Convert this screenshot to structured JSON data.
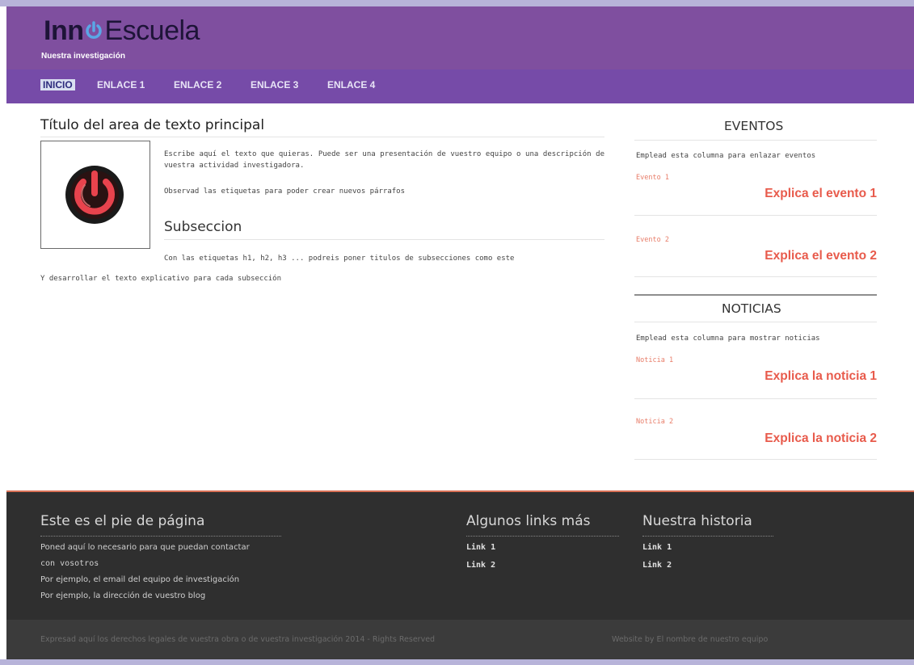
{
  "header": {
    "logo_part1": "Inn",
    "logo_part2": "Escuela",
    "logo_icon": "power-icon",
    "tagline": "Nuestra investigación",
    "bg_color": "#7f4f9f"
  },
  "nav": {
    "items": [
      "INICIO",
      "ENLACE 1",
      "ENLACE 2",
      "ENLACE 3",
      "ENLACE 4"
    ],
    "active": "INICIO",
    "bg_color": "#764ba8"
  },
  "main": {
    "title": "Título del area de texto principal",
    "image_icon": "power-button-icon",
    "para1": "Escribe aquí el texto que quieras. Puede ser una presentación de vuestro equipo o una descripción de vuestra actividad investigadora.",
    "para2": "Observad las etiquetas para poder crear nuevos párrafos",
    "subsection_title": "Subseccion",
    "para3": "Con las etiquetas h1, h2, h3 ... podreis poner titulos de subsecciones como este",
    "para4": "Y desarrollar el texto explicativo para cada subsección"
  },
  "sidebar": {
    "eventos": {
      "title": "EVENTOS",
      "intro": "Emplead esta columna para enlazar eventos",
      "items": [
        {
          "label": "Evento 1",
          "text": "Explica el evento 1"
        },
        {
          "label": "Evento 2",
          "text": "Explica el evento 2"
        }
      ]
    },
    "noticias": {
      "title": "NOTICIAS",
      "intro": "Emplead esta columna para mostrar noticias",
      "items": [
        {
          "label": "Noticia 1",
          "text": "Explica la noticia 1"
        },
        {
          "label": "Noticia 2",
          "text": "Explica la noticia 2"
        }
      ]
    },
    "accent_color": "#e85b4c"
  },
  "footer": {
    "col1": {
      "title": "Este es el pie de página",
      "lines": [
        "Poned aquí lo necesario para que puedan contactar",
        "con vosotros",
        "Por ejemplo, el email del equipo de investigación",
        "Por ejemplo, la dirección de vuestro blog"
      ]
    },
    "col2": {
      "title": "Algunos links más",
      "links": [
        "Link 1",
        "Link 2"
      ]
    },
    "col3": {
      "title": "Nuestra historia",
      "links": [
        "Link 1",
        "Link 2"
      ]
    },
    "copyright": "Expresad aquí los derechos legales de vuestra obra o de vuestra investigación 2014 - Rights Reserved",
    "credit": "Website by El nombre de nuestro equipo",
    "bg_color": "#2f2f2f"
  }
}
